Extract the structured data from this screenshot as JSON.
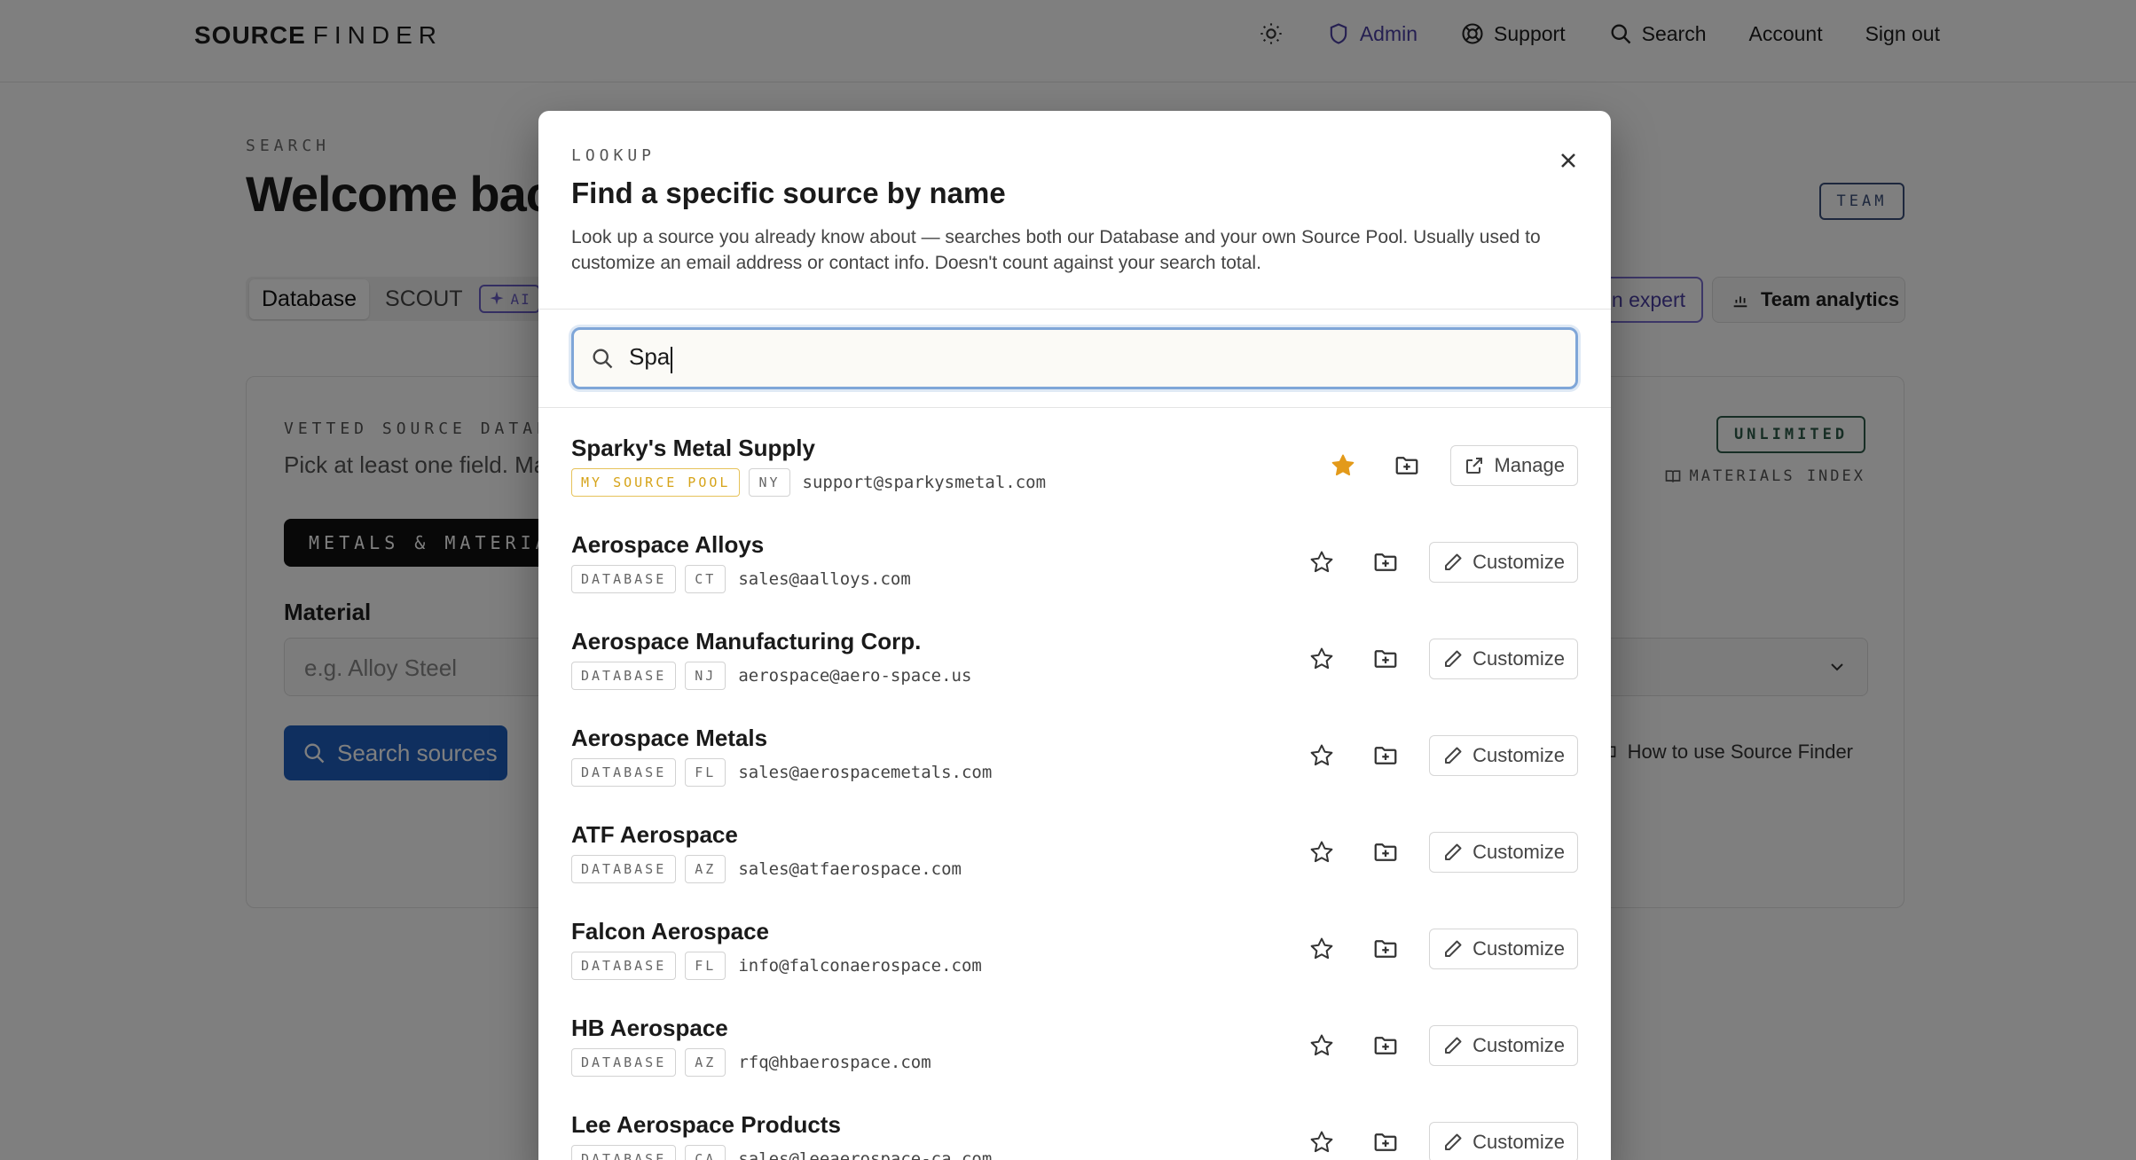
{
  "nav": {
    "brand_bold": "SOURCE",
    "brand_light": "FINDER",
    "theme_icon": "sun-icon",
    "links": [
      {
        "label": "Admin",
        "icon": "shield-icon"
      },
      {
        "label": "Support",
        "icon": "lifebuoy-icon"
      },
      {
        "label": "Search",
        "icon": "search-icon"
      },
      {
        "label": "Account"
      },
      {
        "label": "Sign out"
      }
    ],
    "admin_color": "#4b3fa3"
  },
  "page": {
    "eyebrow": "SEARCH",
    "welcome": "Welcome back",
    "team_badge": "TEAM",
    "tabs": [
      "Database",
      "SCOUT"
    ],
    "ai_badge": "AI",
    "expert_label": "n expert",
    "analytics_label": "Team analytics",
    "card": {
      "label": "VETTED SOURCE DATABASE",
      "subtitle": "Pick at least one field. Ma",
      "unlimited_badge": "UNLIMITED",
      "materials_index": "MATERIALS INDEX",
      "category_pill": "METALS & MATERIALS",
      "material_label": "Material",
      "material_placeholder": "e.g. Alloy Steel",
      "search_button": "Search sources",
      "howto": "How to use Source Finder"
    }
  },
  "modal": {
    "eyebrow": "LOOKUP",
    "title": "Find a specific source by name",
    "description": "Look up a source you already know about — searches both our Database and your own Source Pool. Usually used to customize an email address or contact info. Doesn't count against your search total.",
    "search_value": "Spa",
    "results": [
      {
        "name": "Sparky's Metal Supply",
        "source": "MY SOURCE POOL",
        "state": "NY",
        "email": "support@sparkysmetal.com",
        "starred": true,
        "action": "Manage",
        "action_icon": "external-link-icon"
      },
      {
        "name": "Aerospace Alloys",
        "source": "DATABASE",
        "state": "CT",
        "email": "sales@aalloys.com",
        "starred": false,
        "action": "Customize",
        "action_icon": "pencil-icon"
      },
      {
        "name": "Aerospace Manufacturing Corp.",
        "source": "DATABASE",
        "state": "NJ",
        "email": "aerospace@aero-space.us",
        "starred": false,
        "action": "Customize",
        "action_icon": "pencil-icon"
      },
      {
        "name": "Aerospace Metals",
        "source": "DATABASE",
        "state": "FL",
        "email": "sales@aerospacemetals.com",
        "starred": false,
        "action": "Customize",
        "action_icon": "pencil-icon"
      },
      {
        "name": "ATF Aerospace",
        "source": "DATABASE",
        "state": "AZ",
        "email": "sales@atfaerospace.com",
        "starred": false,
        "action": "Customize",
        "action_icon": "pencil-icon"
      },
      {
        "name": "Falcon Aerospace",
        "source": "DATABASE",
        "state": "FL",
        "email": "info@falconaerospace.com",
        "starred": false,
        "action": "Customize",
        "action_icon": "pencil-icon"
      },
      {
        "name": "HB Aerospace",
        "source": "DATABASE",
        "state": "AZ",
        "email": "rfq@hbaerospace.com",
        "starred": false,
        "action": "Customize",
        "action_icon": "pencil-icon"
      },
      {
        "name": "Lee Aerospace Products",
        "source": "DATABASE",
        "state": "CA",
        "email": "sales@leeaerospace-ca.com",
        "starred": false,
        "action": "Customize",
        "action_icon": "pencil-icon"
      }
    ],
    "star_color": "#e39a1a",
    "pool_chip_color": "#d6a318"
  }
}
